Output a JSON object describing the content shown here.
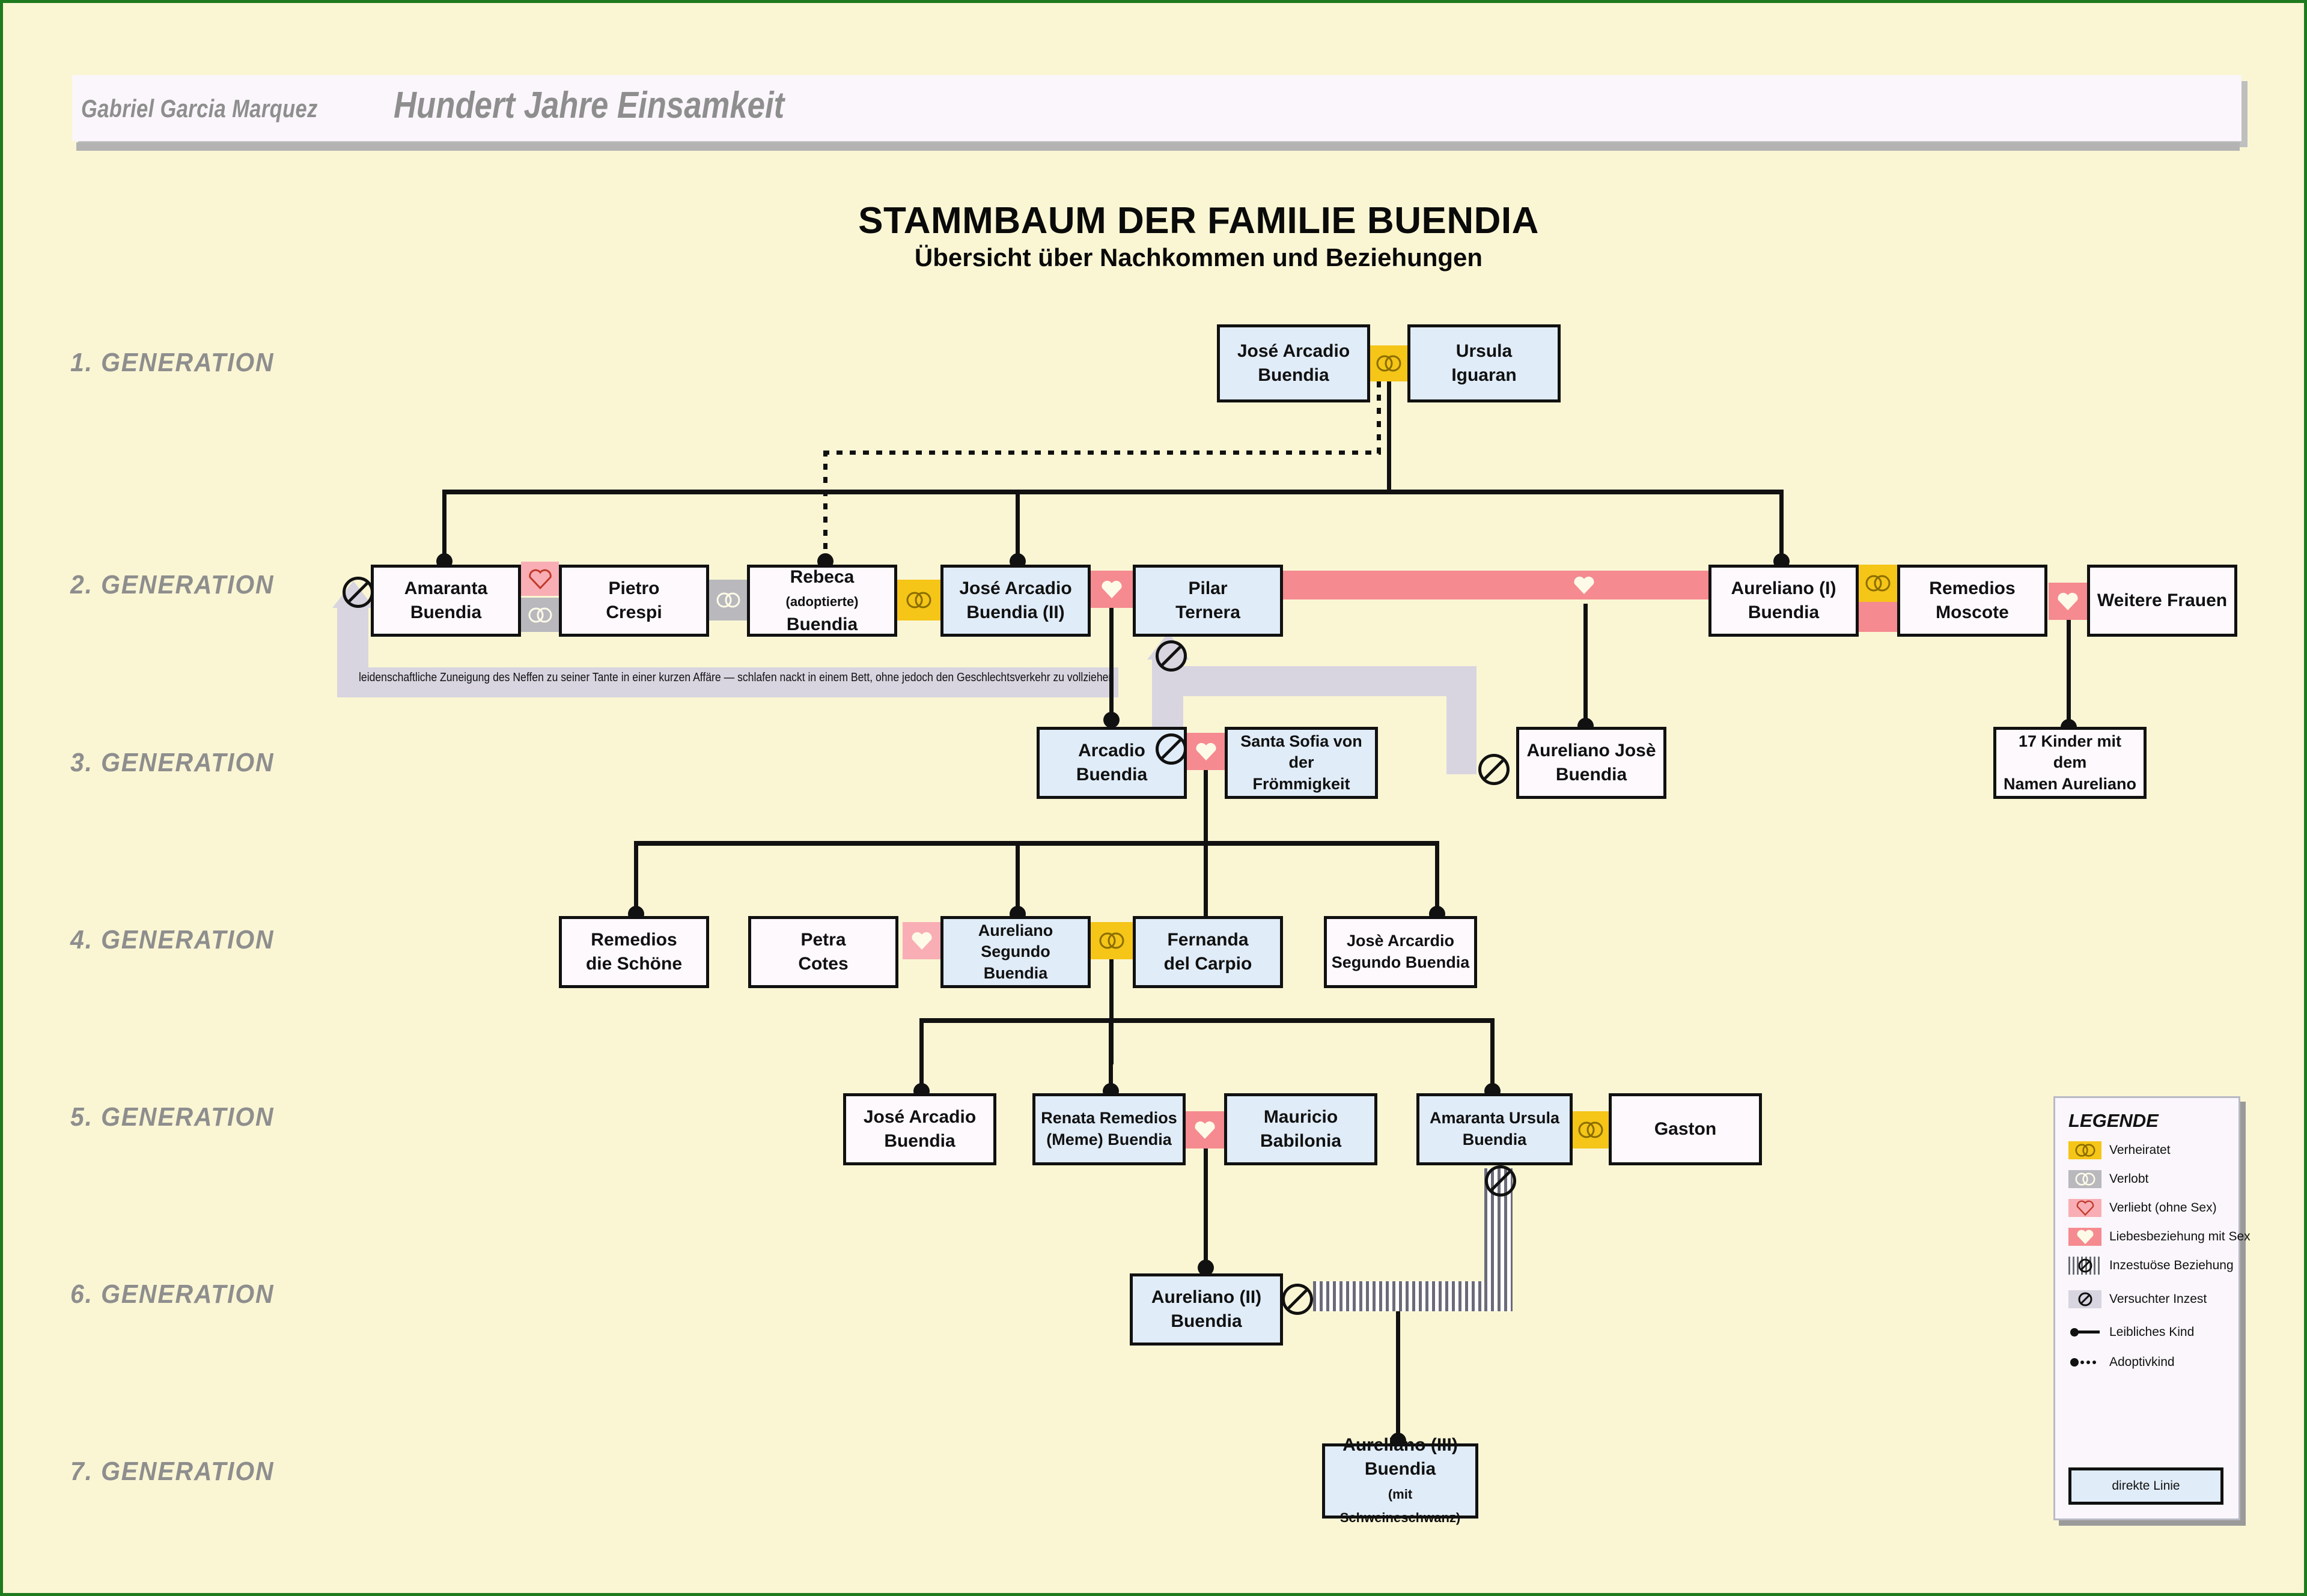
{
  "header": {
    "author": "Gabriel Garcia Marquez",
    "book_title": "Hundert Jahre Einsamkeit"
  },
  "titles": {
    "main": "STAMMBAUM DER FAMILIE BUENDIA",
    "sub": "Übersicht über Nachkommen und Beziehungen"
  },
  "generations": [
    {
      "label": "1. GENERATION"
    },
    {
      "label": "2. GENERATION"
    },
    {
      "label": "3. GENERATION"
    },
    {
      "label": "4. GENERATION"
    },
    {
      "label": "5. GENERATION"
    },
    {
      "label": "6. GENERATION"
    },
    {
      "label": "7. GENERATION"
    }
  ],
  "people": {
    "jose_arcadio_buendia": {
      "line1": "José Arcadio",
      "line2": "Buendia"
    },
    "ursula_iguaran": {
      "line1": "Ursula",
      "line2": "Iguaran"
    },
    "amaranta_buendia": {
      "line1": "Amaranta",
      "line2": "Buendia"
    },
    "pietro_crespi": {
      "line1": "Pietro",
      "line2": "Crespi"
    },
    "rebeca_buendia": {
      "line1": "Rebeca",
      "line2_small": "(adoptierte)",
      "line2": "Buendia"
    },
    "jose_arcadio_buendia_ii": {
      "line1": "José Arcadio",
      "line2": "Buendia (II)"
    },
    "pilar_ternera": {
      "line1": "Pilar",
      "line2": "Ternera"
    },
    "aureliano_i_buendia": {
      "line1": "Aureliano (I)",
      "line2": "Buendia"
    },
    "remedios_moscote": {
      "line1": "Remedios",
      "line2": "Moscote"
    },
    "weitere_frauen": {
      "line1": "Weitere Frauen"
    },
    "arcadio_buendia": {
      "line1": "Arcadio",
      "line2": "Buendia"
    },
    "santa_sofia": {
      "line1": "Santa Sofia von der",
      "line2": "Frömmigkeit"
    },
    "aureliano_jose_buendia": {
      "line1": "Aureliano Josè",
      "line2": "Buendia"
    },
    "siebzehn_kinder": {
      "line1": "17 Kinder mit dem",
      "line2": "Namen Aureliano"
    },
    "remedios_die_schoene": {
      "line1": "Remedios",
      "line2": "die Schöne"
    },
    "petra_cotes": {
      "line1": "Petra",
      "line2": "Cotes"
    },
    "aureliano_segundo": {
      "line1": "Aureliano Segundo",
      "line2": "Buendia"
    },
    "fernanda_del_carpio": {
      "line1": "Fernanda",
      "line2": "del Carpio"
    },
    "jose_arcadio_segundo": {
      "line1": "Josè Arcardio",
      "line2": "Segundo Buendia"
    },
    "jose_arcadio_buendia_g5": {
      "line1": "José Arcadio",
      "line2": "Buendia"
    },
    "renata_remedios": {
      "line1": "Renata Remedios",
      "line2": "(Meme) Buendia"
    },
    "mauricio_babilonia": {
      "line1": "Mauricio",
      "line2": "Babilonia"
    },
    "amaranta_ursula": {
      "line1": "Amaranta Ursula",
      "line2": "Buendia"
    },
    "gaston": {
      "line1": "Gaston"
    },
    "aureliano_ii_buendia": {
      "line1": "Aureliano (II)",
      "line2": "Buendia"
    },
    "aureliano_iii_buendia": {
      "line1": "Aureliano (III)",
      "line2": "Buendia",
      "line3_small": "(mit Schweineschwanz)"
    }
  },
  "annotation": {
    "amaranta_note": "leidenschaftliche Zuneigung des Neffen zu seiner Tante  in einer kurzen Affäre — schlafen nackt in einem Bett, ohne jedoch den Geschlechtsverkehr zu vollziehen"
  },
  "legend": {
    "title": "LEGENDE",
    "items": [
      {
        "icon": "wedding-rings-icon",
        "label": "Verheiratet"
      },
      {
        "icon": "engagement-rings-icon",
        "label": "Verlobt"
      },
      {
        "icon": "heart-outline-icon",
        "label": "Verliebt (ohne Sex)"
      },
      {
        "icon": "heart-filled-icon",
        "label": "Liebesbeziehung mit Sex"
      },
      {
        "icon": "striped-no-entry-icon",
        "label": "Inzestuöse Beziehung"
      },
      {
        "icon": "no-entry-icon",
        "label": "Versuchter Inzest"
      },
      {
        "icon": "solid-line-dot-icon",
        "label": "Leibliches Kind"
      },
      {
        "icon": "dotted-line-dot-icon",
        "label": "Adoptivkind"
      }
    ],
    "direct_line_label": "direkte Linie"
  },
  "colors": {
    "page_bg": "#faf6d4",
    "page_border": "#1e7a1e",
    "married": "#f5c518",
    "engaged": "#b8b8bd",
    "love_no_sex": "#f8aeb4",
    "love_sex": "#f58a90",
    "incest_grey": "#d8d5e0",
    "bloodline_box": "#e0ecf8",
    "other_box": "#fdf9fd",
    "line": "#111111"
  }
}
